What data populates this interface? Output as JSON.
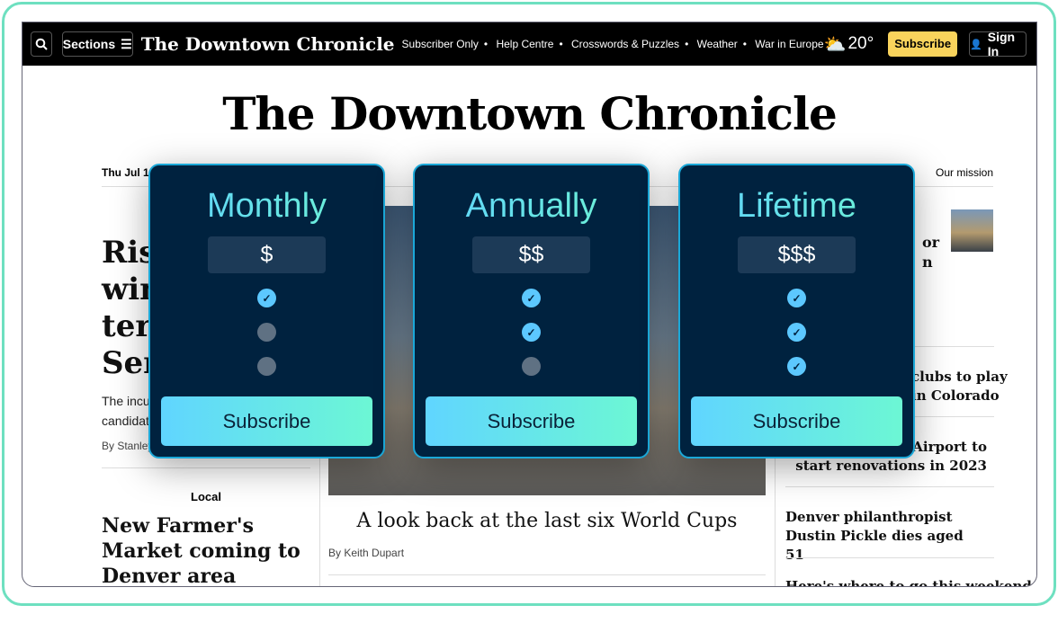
{
  "header": {
    "sections_label": "Sections",
    "logo": "The Downtown Chronicle",
    "nav": [
      "Subscriber Only",
      "Help Centre",
      "Crosswords & Puzzles",
      "Weather",
      "War in Europe"
    ],
    "weather_temp": "20°",
    "subscribe_label": "Subscribe",
    "signin_label": "Sign In",
    "subscribe_color": "#f9d35c"
  },
  "masthead": "The Downtown Chronicle",
  "dateline": "Thu Jul 1",
  "mission": "Our mission",
  "lead": {
    "headline": [
      "Risk",
      "win",
      "terr",
      "Sen"
    ],
    "dek": [
      "The incu",
      "candidat"
    ],
    "byline": "By Stanley"
  },
  "local": {
    "section": "Local",
    "headline": "New Farmer's Market coming to Denver area"
  },
  "center": {
    "caption": "A look back at the last six World Cups",
    "byline": "By Keith Dupart"
  },
  "right": {
    "items": [
      "or\nn",
      "clubs to play\nin Colorado",
      "l Airport to\nstart renovations in 2023",
      "Denver philanthropist Dustin Pickle dies aged 51",
      "Here's where to go this weekend"
    ]
  },
  "plans": [
    {
      "name": "Monthly",
      "price": "$",
      "features": [
        true,
        false,
        false
      ],
      "cta": "Subscribe"
    },
    {
      "name": "Annually",
      "price": "$$",
      "features": [
        true,
        true,
        false
      ],
      "cta": "Subscribe"
    },
    {
      "name": "Lifetime",
      "price": "$$$",
      "features": [
        true,
        true,
        true
      ],
      "cta": "Subscribe"
    }
  ]
}
